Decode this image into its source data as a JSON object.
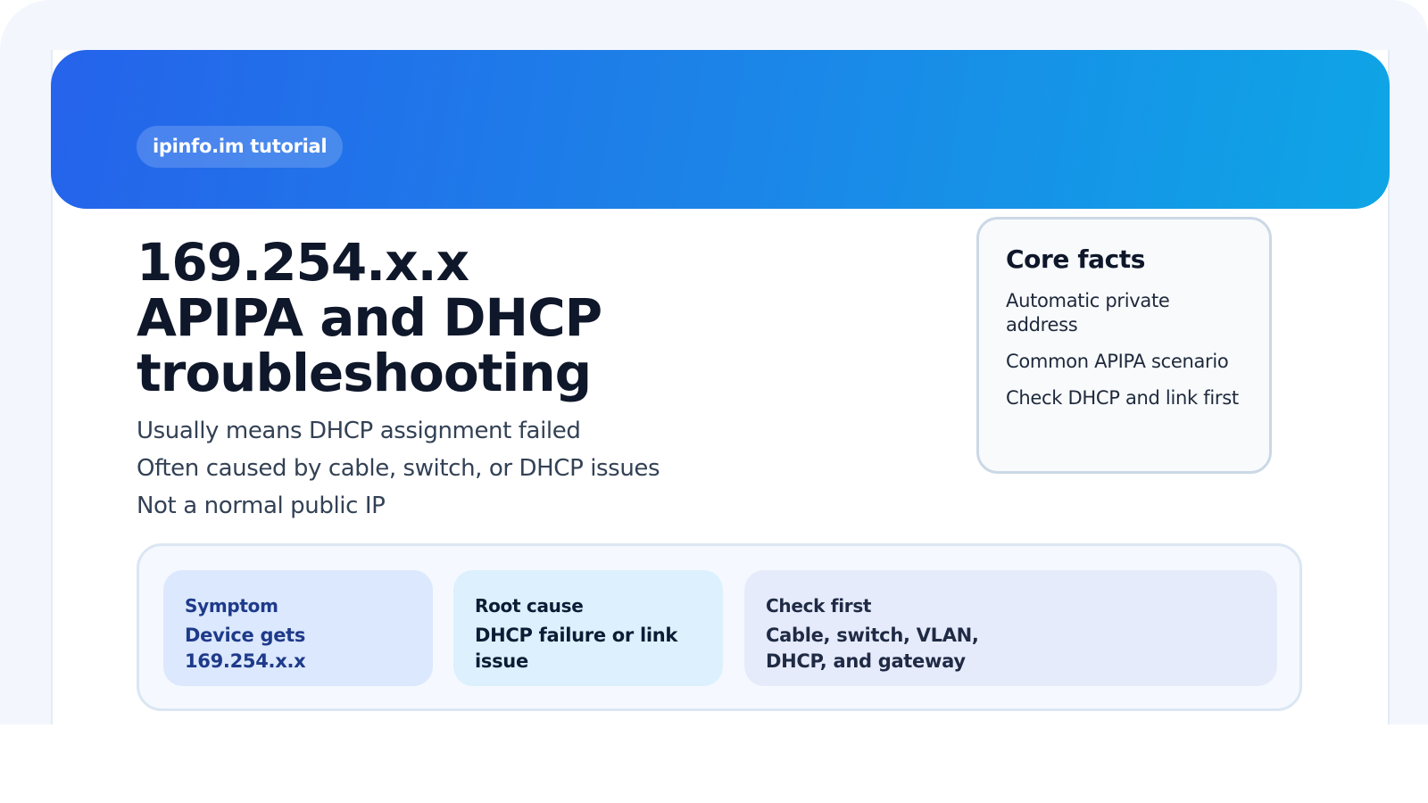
{
  "header": {
    "badge": "ipinfo.im tutorial",
    "title_lines": [
      "169.254.x.x",
      "APIPA and DHCP",
      "troubleshooting"
    ]
  },
  "summary": [
    "Usually means DHCP assignment failed",
    "Often caused by cable, switch, or DHCP issues",
    "Not a normal public IP"
  ],
  "core_facts": {
    "heading": "Core facts",
    "items": [
      "Automatic private address",
      "Common APIPA scenario",
      "Check DHCP and link first"
    ]
  },
  "tiles": [
    {
      "label": "Symptom",
      "value": "Device gets 169.254.x.x"
    },
    {
      "label": "Root cause",
      "value": "DHCP failure or link issue"
    },
    {
      "label": "Check first",
      "value": "Cable, switch, VLAN, DHCP, and gateway"
    }
  ],
  "colors": {
    "banner_start": "#2563eb",
    "banner_end": "#0ea5e6",
    "title": "#0f172a"
  }
}
